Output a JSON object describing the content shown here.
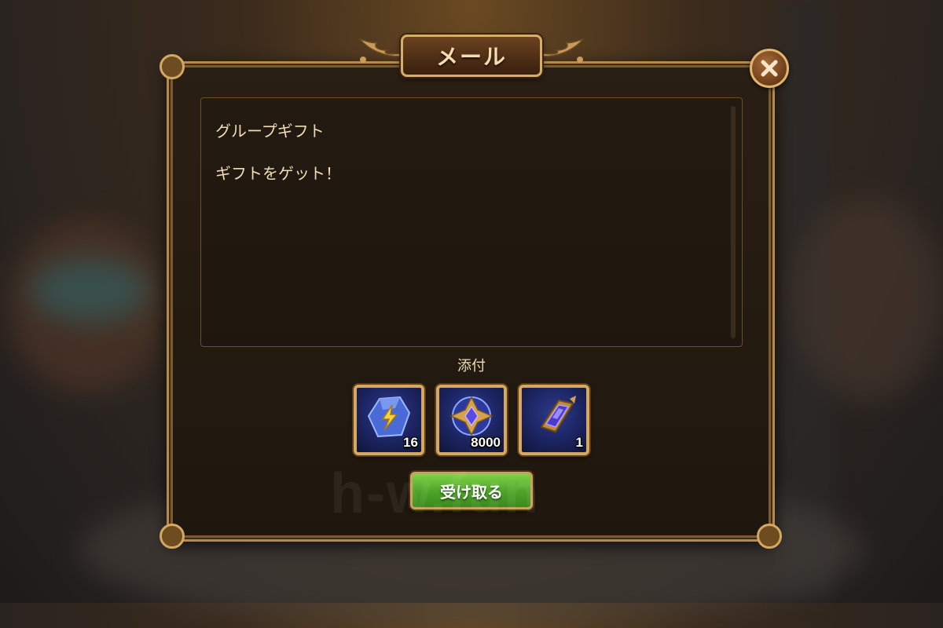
{
  "dialog": {
    "title": "メール",
    "close_icon": "close-x-icon"
  },
  "message": {
    "subject": "グループギフト",
    "body": "ギフトをゲット！"
  },
  "attachments": {
    "label": "添付",
    "items": [
      {
        "icon": "lightning-gem-icon",
        "count": "16"
      },
      {
        "icon": "star-emblem-icon",
        "count": "8000"
      },
      {
        "icon": "crystal-sword-icon",
        "count": "1"
      }
    ]
  },
  "actions": {
    "claim_label": "受け取る"
  },
  "watermark": "h-w.fun",
  "colors": {
    "gold_border": "#d4a862",
    "text": "#f1dcb8",
    "button_green": "#4fa62a"
  }
}
